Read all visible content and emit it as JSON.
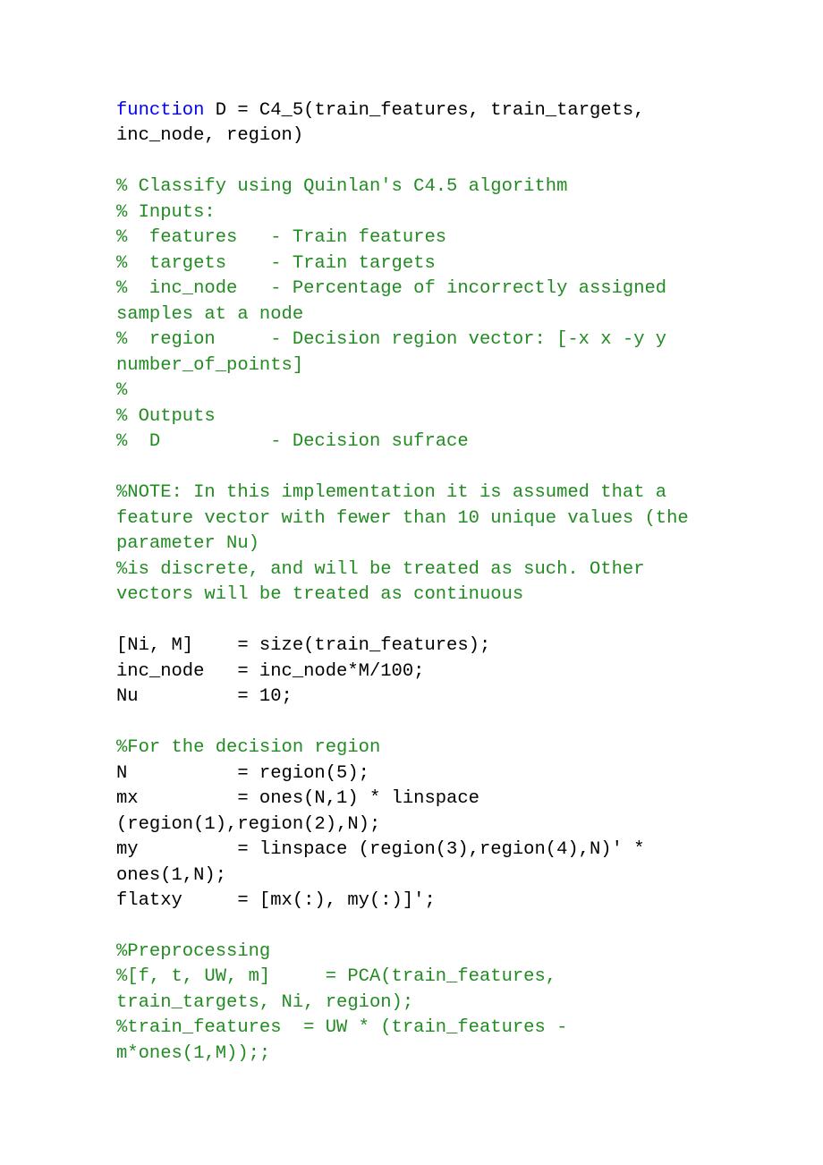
{
  "lines": [
    {
      "segments": [
        {
          "cls": "keyword",
          "text": "function"
        },
        {
          "cls": "plain",
          "text": " D = C4_5(train_features, train_targets, inc_node, region)"
        }
      ]
    },
    {
      "segments": [
        {
          "cls": "plain",
          "text": ""
        }
      ]
    },
    {
      "segments": [
        {
          "cls": "comment",
          "text": "% Classify using Quinlan's C4.5 algorithm"
        }
      ]
    },
    {
      "segments": [
        {
          "cls": "comment",
          "text": "% Inputs:"
        }
      ]
    },
    {
      "segments": [
        {
          "cls": "comment",
          "text": "%  features   - Train features"
        }
      ]
    },
    {
      "segments": [
        {
          "cls": "comment",
          "text": "%  targets    - Train targets"
        }
      ]
    },
    {
      "segments": [
        {
          "cls": "comment",
          "text": "%  inc_node   - Percentage of incorrectly assigned samples at a node"
        }
      ]
    },
    {
      "segments": [
        {
          "cls": "comment",
          "text": "%  region     - Decision region vector: [-x x -y y number_of_points]"
        }
      ]
    },
    {
      "segments": [
        {
          "cls": "comment",
          "text": "%"
        }
      ]
    },
    {
      "segments": [
        {
          "cls": "comment",
          "text": "% Outputs"
        }
      ]
    },
    {
      "segments": [
        {
          "cls": "comment",
          "text": "%  D          - Decision sufrace"
        }
      ]
    },
    {
      "segments": [
        {
          "cls": "plain",
          "text": ""
        }
      ]
    },
    {
      "segments": [
        {
          "cls": "comment",
          "text": "%NOTE: In this implementation it is assumed that a feature vector with fewer than 10 unique values (the parameter Nu)"
        }
      ]
    },
    {
      "segments": [
        {
          "cls": "comment",
          "text": "%is discrete, and will be treated as such. Other vectors will be treated as continuous"
        }
      ]
    },
    {
      "segments": [
        {
          "cls": "plain",
          "text": ""
        }
      ]
    },
    {
      "segments": [
        {
          "cls": "plain",
          "text": "[Ni, M]    = size(train_features);"
        }
      ]
    },
    {
      "segments": [
        {
          "cls": "plain",
          "text": "inc_node   = inc_node*M/100;"
        }
      ]
    },
    {
      "segments": [
        {
          "cls": "plain",
          "text": "Nu         = 10;"
        }
      ]
    },
    {
      "segments": [
        {
          "cls": "plain",
          "text": ""
        }
      ]
    },
    {
      "segments": [
        {
          "cls": "comment",
          "text": "%For the decision region"
        }
      ]
    },
    {
      "segments": [
        {
          "cls": "plain",
          "text": "N          = region(5);"
        }
      ]
    },
    {
      "segments": [
        {
          "cls": "plain",
          "text": "mx         = ones(N,1) * linspace (region(1),region(2),N);"
        }
      ]
    },
    {
      "segments": [
        {
          "cls": "plain",
          "text": "my         = linspace (region(3),region(4),N)' * ones(1,N);"
        }
      ]
    },
    {
      "segments": [
        {
          "cls": "plain",
          "text": "flatxy     = [mx(:), my(:)]';"
        }
      ]
    },
    {
      "segments": [
        {
          "cls": "plain",
          "text": ""
        }
      ]
    },
    {
      "segments": [
        {
          "cls": "comment",
          "text": "%Preprocessing"
        }
      ]
    },
    {
      "segments": [
        {
          "cls": "comment",
          "text": "%[f, t, UW, m]     = PCA(train_features, train_targets, Ni, region);"
        }
      ]
    },
    {
      "segments": [
        {
          "cls": "comment",
          "text": "%train_features  = UW * (train_features - m*ones(1,M));;"
        }
      ]
    }
  ]
}
